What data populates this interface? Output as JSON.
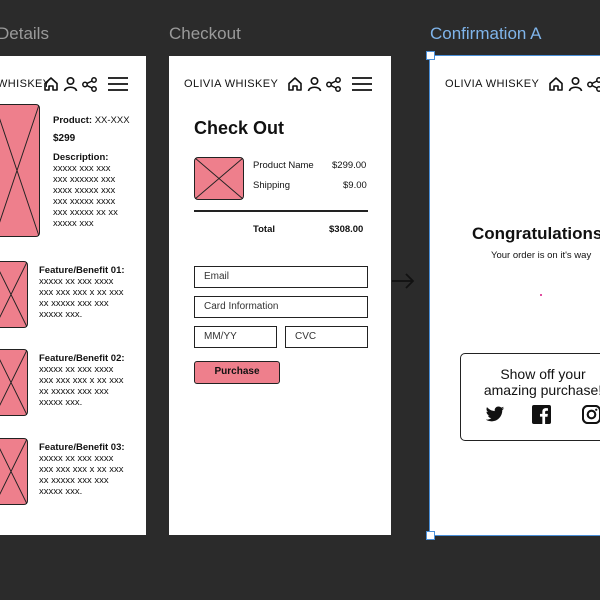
{
  "frames": {
    "details": {
      "label": "Details",
      "brand": "WHISKEY",
      "product_label": "Product:",
      "product_value": "XX-XXX",
      "price": "$299",
      "description_label": "Description:",
      "description_lines": [
        "xxxxx xxx xxx",
        "xxx xxxxxx xxx",
        "xxxx xxxxx xxx",
        "xxx xxxxx xxxx",
        "xxx xxxxx xx xx",
        "xxxxx xxx"
      ],
      "features": [
        {
          "title": "Feature/Benefit 01:",
          "lines": [
            "xxxxx xx xxx xxxx",
            "xxx xxx xxx x xx xxx",
            "xx xxxxx xxx xxx",
            "xxxxx xxx."
          ]
        },
        {
          "title": "Feature/Benefit 02:",
          "lines": [
            "xxxxx xx xxx xxxx",
            "xxx xxx xxx x xx xxx",
            "xx xxxxx xxx xxx",
            "xxxxx xxx."
          ]
        },
        {
          "title": "Feature/Benefit 03:",
          "lines": [
            "xxxxx xx xxx xxxx",
            "xxx xxx xxx x xx xxx",
            "xx xxxxx xxx xxx",
            "xxxxx xxx."
          ]
        }
      ]
    },
    "checkout": {
      "label": "Checkout",
      "brand": "OLIVIA WHISKEY",
      "title": "Check Out",
      "product_name": "Product Name",
      "product_price": "$299.00",
      "shipping_label": "Shipping",
      "shipping_price": "$9.00",
      "total_label": "Total",
      "total_price": "$308.00",
      "email_placeholder": "Email",
      "card_placeholder": "Card Information",
      "expiry_placeholder": "MM/YY",
      "cvc_placeholder": "CVC",
      "purchase_label": "Purchase"
    },
    "confirmation": {
      "label": "Confirmation A",
      "brand": "OLIVIA WHISKEY",
      "heading": "Congratulations",
      "subtext": "Your order is on it's way",
      "share_line1": "Show off your",
      "share_line2": "amazing purchase!"
    }
  },
  "colors": {
    "canvas": "#2b2b2b",
    "placeholder_fill": "#ee7f8c",
    "selection": "#4a8fd8"
  }
}
